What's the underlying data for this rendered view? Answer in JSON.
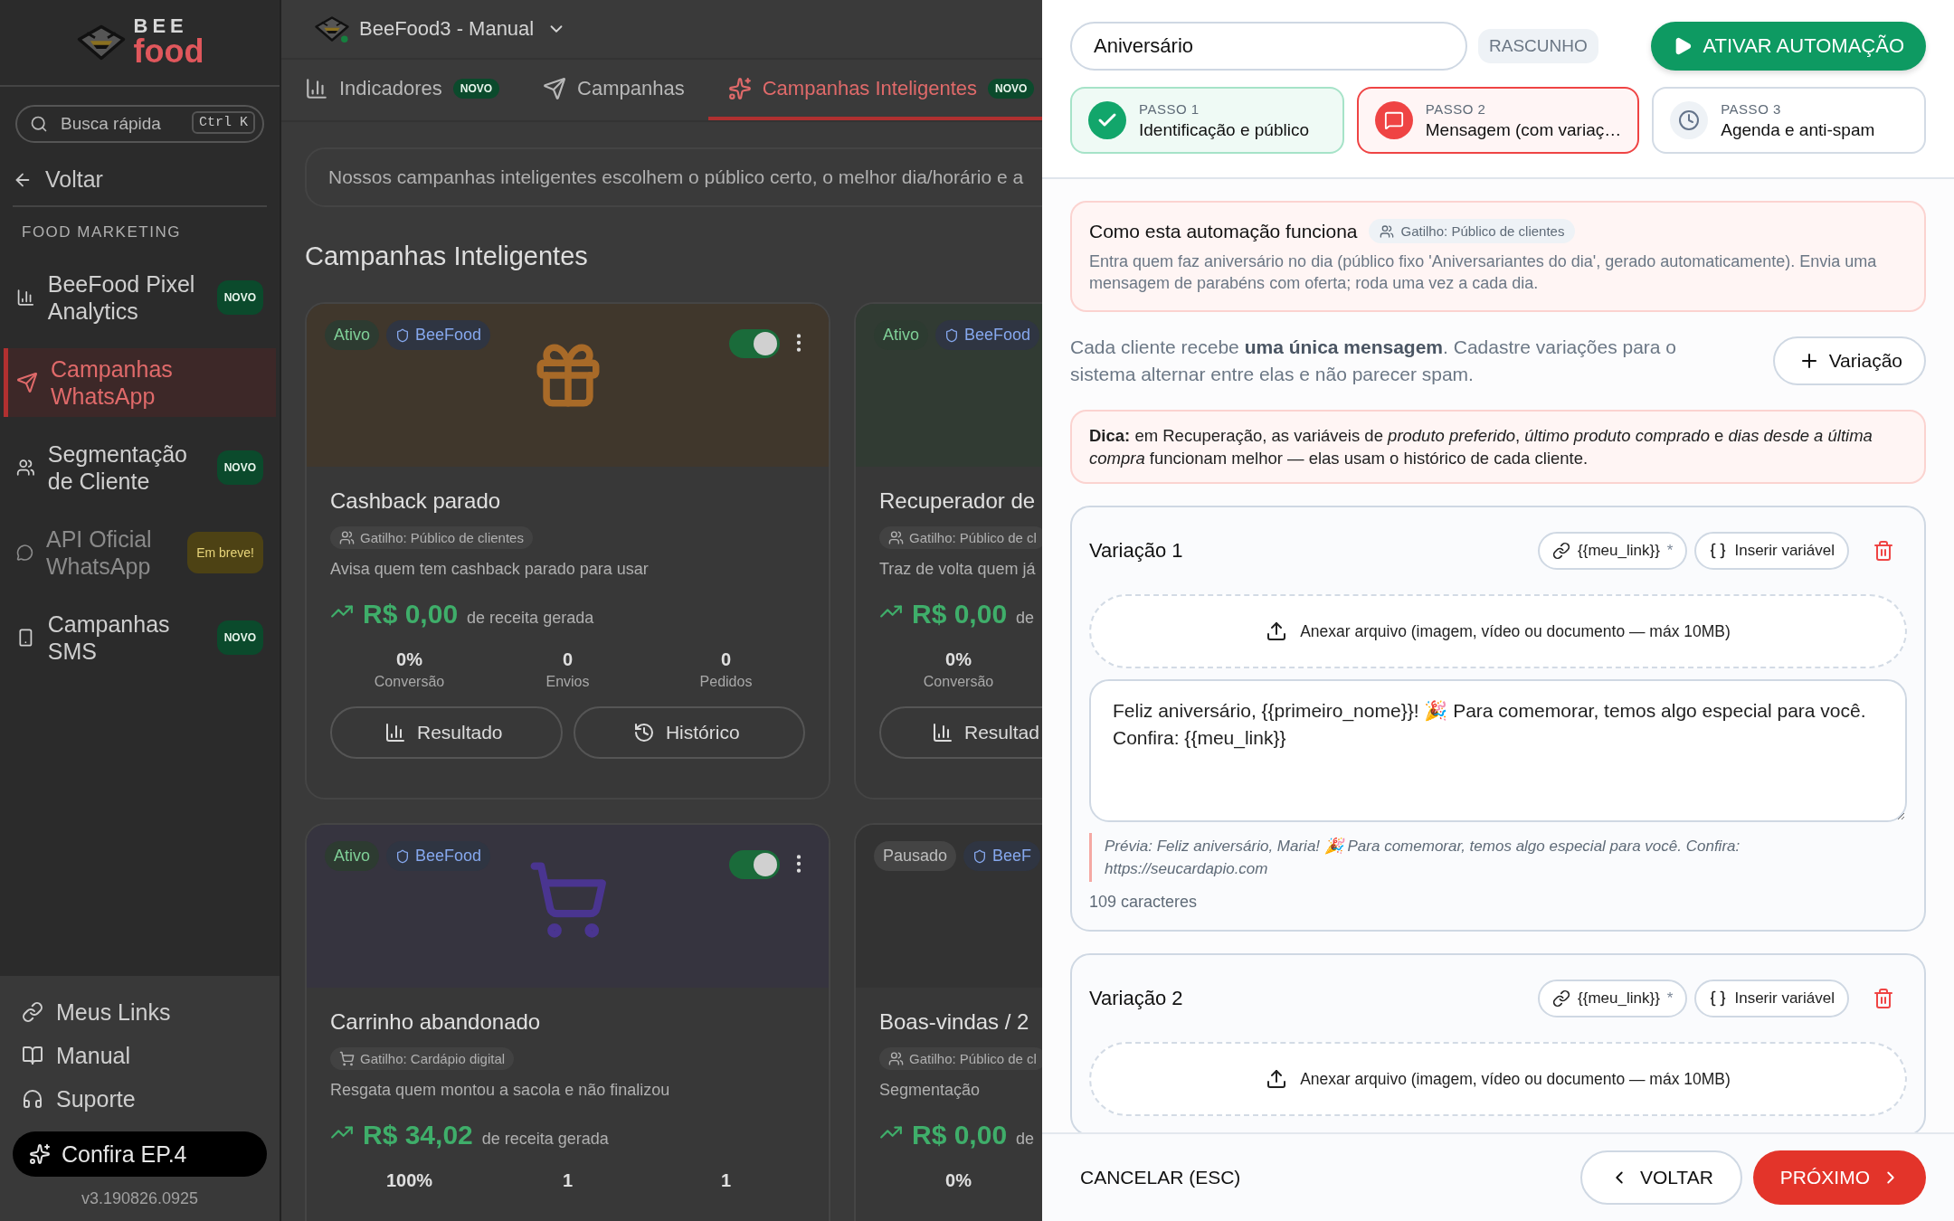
{
  "sidebar": {
    "logo": {
      "top": "BEE",
      "bottom": "food"
    },
    "search": {
      "placeholder": "Busca rápida",
      "shortcut": "Ctrl K"
    },
    "back": "Voltar",
    "section": "FOOD MARKETING",
    "items": [
      {
        "label": "BeeFood Pixel Analytics",
        "badge": "NOVO",
        "selected": false,
        "disabled": false
      },
      {
        "label": "Campanhas WhatsApp",
        "selected": true,
        "disabled": false
      },
      {
        "label": "Segmentação de Cliente",
        "badge": "NOVO",
        "selected": false,
        "disabled": false
      },
      {
        "label": "API Oficial WhatsApp",
        "badge": "Em breve!",
        "selected": false,
        "disabled": true
      },
      {
        "label": "Campanhas SMS",
        "badge": "NOVO",
        "selected": false,
        "disabled": false
      }
    ],
    "footer_links": [
      "Meus Links",
      "Manual",
      "Suporte"
    ],
    "promo": "Confira EP.4",
    "version": "v3.190826.0925"
  },
  "header": {
    "store": "BeeFood3 - Manual"
  },
  "tabs": [
    {
      "label": "Indicadores",
      "badge": "NOVO",
      "selected": false
    },
    {
      "label": "Campanhas",
      "selected": false
    },
    {
      "label": "Campanhas Inteligentes",
      "badge": "NOVO",
      "selected": true
    }
  ],
  "banner": "Nossos campanhas inteligentes escolhem o público certo, o melhor dia/horário e a",
  "heading": "Campanhas Inteligentes",
  "cards": [
    {
      "status": "Ativo",
      "paused": false,
      "brand": "BeeFood",
      "toggle_on": true,
      "title": "Cashback parado",
      "trigger": "Gatilho: Público de clientes",
      "description": "Avisa quem tem cashback parado para usar",
      "revenue": "R$ 0,00",
      "revenue_label": "de receita gerada",
      "metrics": [
        {
          "value": "0%",
          "label": "Conversão"
        },
        {
          "value": "0",
          "label": "Envios"
        },
        {
          "value": "0",
          "label": "Pedidos"
        }
      ],
      "buttons": [
        "Resultado",
        "Histórico"
      ]
    },
    {
      "status": "Ativo",
      "paused": false,
      "brand": "BeeFood",
      "title": "Recuperador de",
      "trigger": "Gatilho: Público de cl",
      "description": "Traz de volta quem já",
      "revenue": "R$ 0,00",
      "revenue_label": "de",
      "metrics": [
        {
          "value": "0%",
          "label": "Conversão"
        }
      ],
      "buttons": [
        "Resultad"
      ]
    },
    {
      "status": "Ativo",
      "paused": false,
      "brand": "BeeFood",
      "toggle_on": true,
      "title": "Carrinho abandonado",
      "trigger": "Gatilho: Cardápio digital",
      "description": "Resgata quem montou a sacola e não finalizou",
      "revenue": "R$ 34,02",
      "revenue_label": "de receita gerada",
      "metrics": [
        {
          "value": "100%"
        },
        {
          "value": "1"
        },
        {
          "value": "1"
        }
      ]
    },
    {
      "status": "Pausado",
      "paused": true,
      "brand": "BeeF",
      "title": "Boas-vindas / 2",
      "trigger": "Gatilho: Público de cl",
      "description": "Segmentação",
      "revenue": "R$ 0,00",
      "revenue_label": "de",
      "metrics": [
        {
          "value": "0%"
        }
      ]
    }
  ],
  "automation": {
    "name": "Aniversário",
    "status": "RASCUNHO",
    "activate": "ATIVAR AUTOMAÇÃO",
    "steps": [
      {
        "label": "PASSO 1",
        "title": "Identificação e público",
        "done": true,
        "selected": false
      },
      {
        "label": "PASSO 2",
        "title": "Mensagem (com variaç…",
        "done": false,
        "selected": true
      },
      {
        "label": "PASSO 3",
        "title": "Agenda e anti-spam",
        "done": false,
        "selected": false
      }
    ],
    "how": {
      "title": "Como esta automação funciona",
      "trigger": "Gatilho: Público de clientes",
      "text": "Entra quem faz aniversário no dia (público fixo 'Aniversariantes do dia', gerado automaticamente). Envia uma mensagem de parabéns com oferta; roda uma vez a cada dia."
    },
    "intro": "Cada cliente recebe **uma única mensagem**. Cadastre variações para o sistema alternar entre elas e não parecer spam.",
    "add_variation": "Variação",
    "tip": "**Dica:** em Recuperação, as variáveis de *produto preferido*, *último produto comprado* e *dias desde a última compra* funcionam melhor — elas usam o histórico de cada cliente.",
    "variations": [
      {
        "title": "Variação 1",
        "link_chip": "{{meu_link}}",
        "required_mark": "*",
        "insert": "Inserir variável",
        "attach": "Anexar arquivo (imagem, vídeo ou documento — máx 10MB)",
        "message": "Feliz aniversário, {{primeiro_nome}}! 🎉 Para comemorar, temos algo especial para você. Confira: {{meu_link}}",
        "preview": "Prévia: Feliz aniversário, Maria! 🎉 Para comemorar, temos algo especial para você. Confira: https://seucardapio.com",
        "count": "109 caracteres"
      },
      {
        "title": "Variação 2",
        "link_chip": "{{meu_link}}",
        "required_mark": "*",
        "insert": "Inserir variável",
        "attach": "Anexar arquivo (imagem, vídeo ou documento — máx 10MB)"
      }
    ],
    "footer": {
      "cancel": "CANCELAR (ESC)",
      "back": "VOLTAR",
      "next": "PRÓXIMO"
    }
  }
}
